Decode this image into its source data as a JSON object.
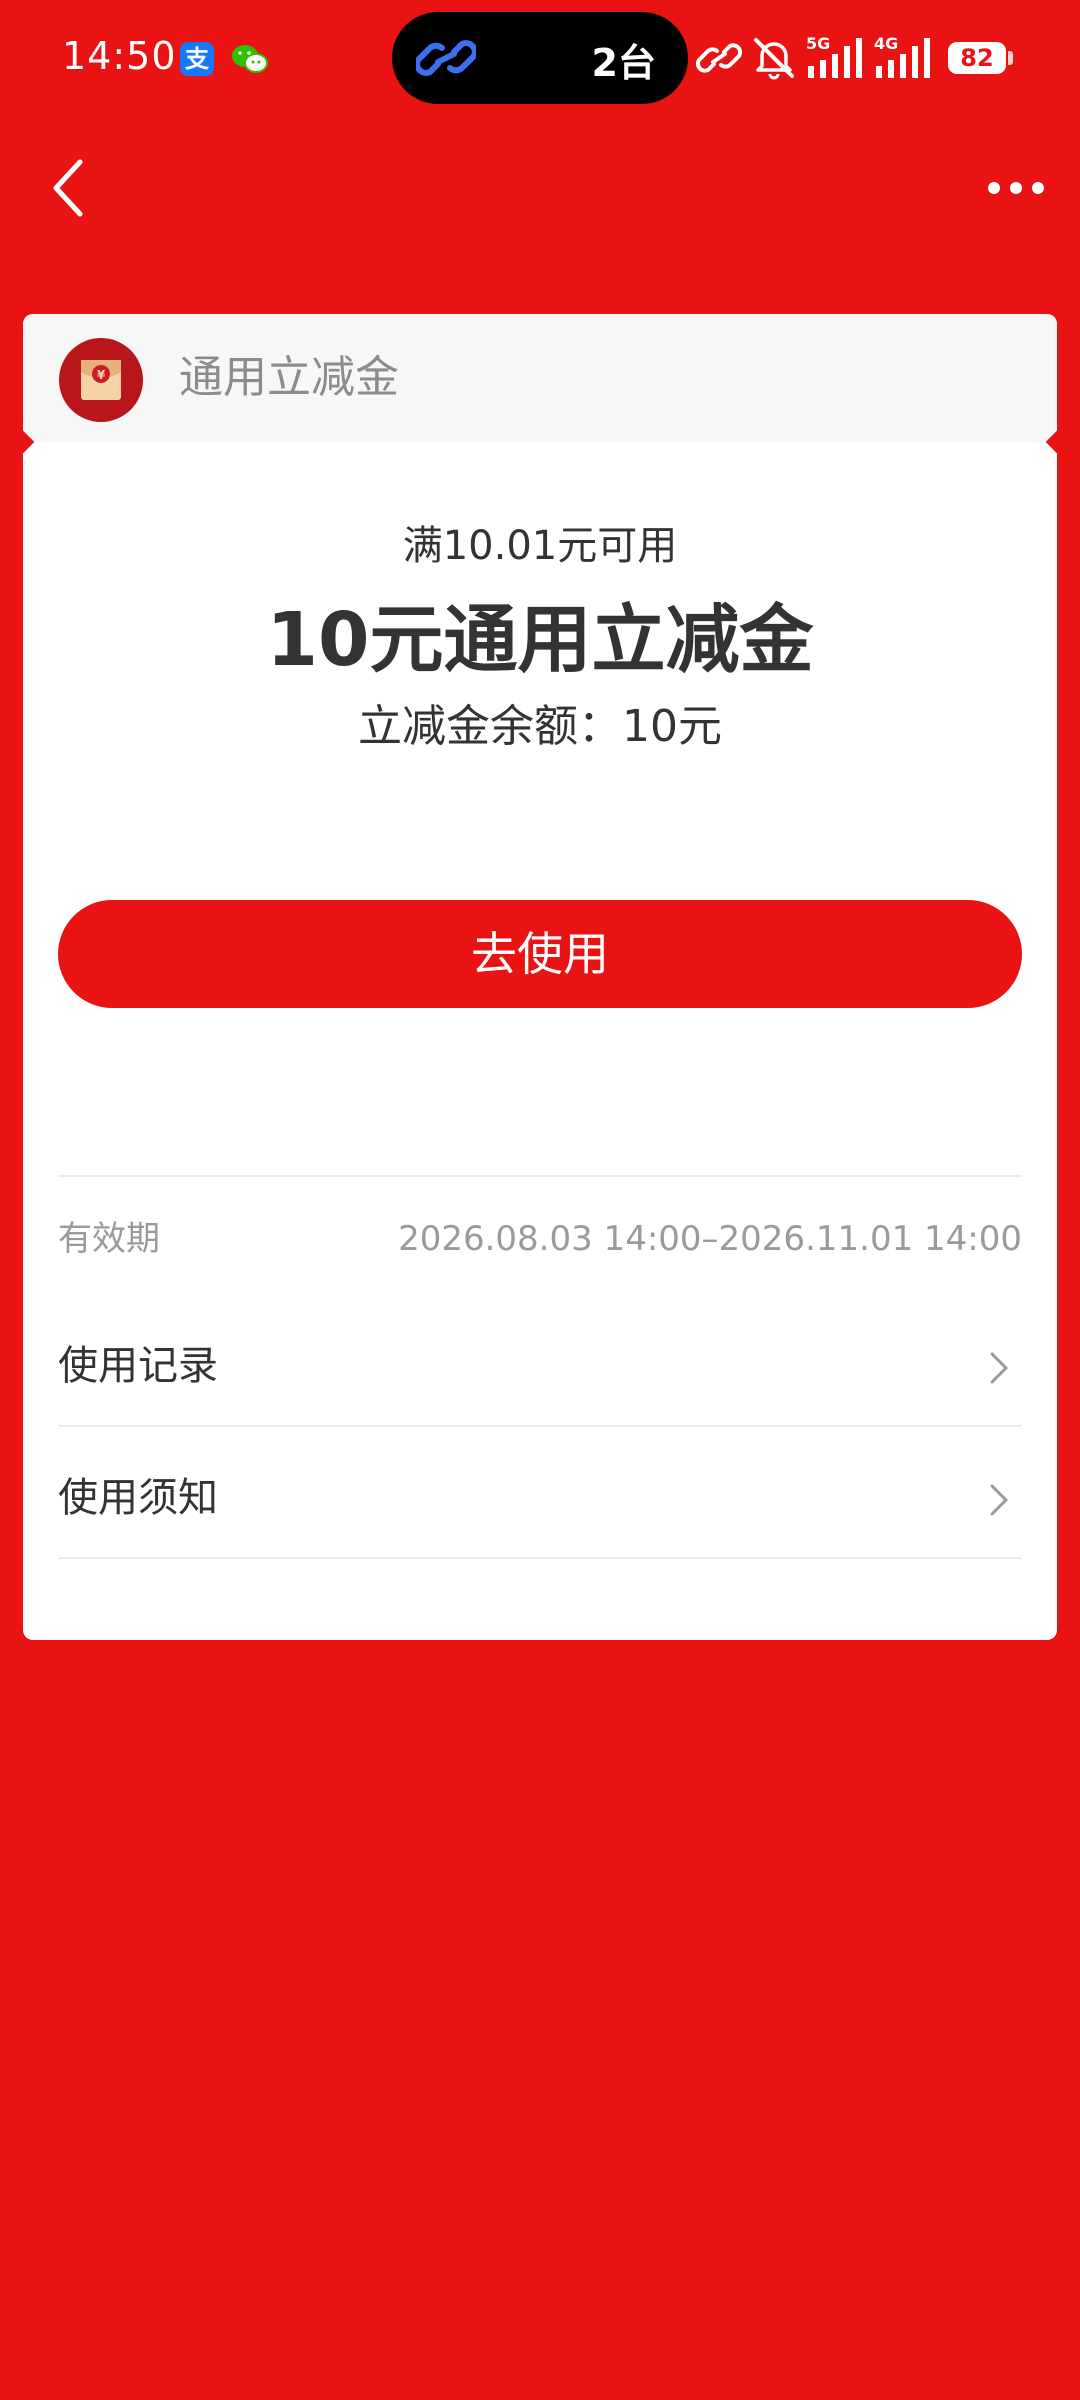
{
  "status_bar": {
    "time": "14:50",
    "alipay_glyph": "支",
    "island_text": "2台",
    "battery_level": "82",
    "network_5g": "5G",
    "network_4g": "4G",
    "icons": [
      "alipay-icon",
      "wechat-icon",
      "link-icon",
      "mute-icon",
      "signal-5g-icon",
      "signal-4g-icon",
      "battery-icon"
    ]
  },
  "nav": {
    "icons": [
      "chevron-left-icon",
      "more-icon"
    ]
  },
  "card": {
    "header_title": "通用立减金",
    "header_icon": "red-packet-icon",
    "header_icon_glyph": "¥",
    "condition": "满10.01元可用",
    "title": "10元通用立减金",
    "balance": "立减金余额：10元",
    "use_button": "去使用",
    "validity_label": "有效期",
    "validity_value": "2026.08.03 14:00–2026.11.01 14:00",
    "rows": [
      {
        "label": "使用记录",
        "icon": "chevron-right-icon"
      },
      {
        "label": "使用须知",
        "icon": "chevron-right-icon"
      }
    ]
  },
  "colors": {
    "background": "#e91313",
    "card": "#ffffff",
    "header": "#f7f7f7",
    "text_primary": "#333333",
    "text_secondary": "#9a9a9a"
  }
}
